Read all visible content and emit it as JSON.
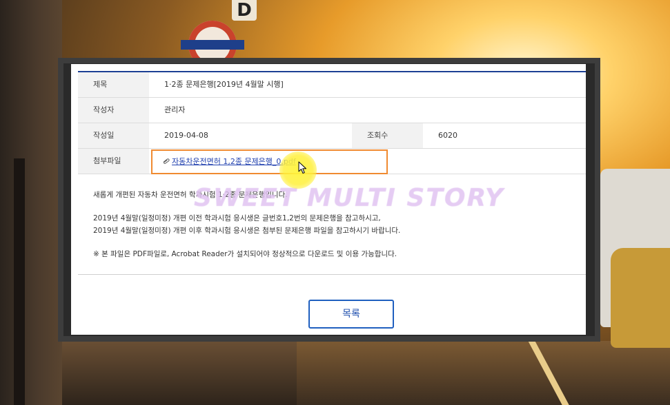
{
  "background": {
    "sign_letter": "D"
  },
  "post": {
    "rows": {
      "title": {
        "label": "제목",
        "value": "1·2종 문제은행[2019년 4월말 시행]"
      },
      "author": {
        "label": "작성자",
        "value": "관리자"
      },
      "date": {
        "label": "작성일",
        "value": "2019-04-08"
      },
      "views": {
        "label": "조회수",
        "value": "6020"
      },
      "attachment": {
        "label": "첨부파일",
        "file_name": "자동차운전면허 1,2종 문제은행_0.pdf",
        "icon": "paperclip-icon"
      }
    },
    "content": {
      "line1": "새롭게 개편된 자동차 운전면허 학과시험 1·2종 문제은행입니다.",
      "line2": "2019년 4월말(일정미정) 개편 이전 학과시험 응시생은 글번호1,2번의 문제은행을 참고하시고,",
      "line3": "2019년 4월말(일정미정) 개편 이후 학과시험 응시생은 첨부된 문제은행 파일을 참고하시기 바랍니다.",
      "line4": "※ 본 파일은 PDF파일로, Acrobat Reader가 설치되어야 정상적으로 다운로드 및 이용 가능합니다."
    },
    "watermark": "SWEET MULTI STORY",
    "list_button": "목록"
  },
  "colors": {
    "accent_line": "#1c3f94",
    "highlight_border": "#f08a30",
    "link": "#1f3fae",
    "button_border": "#1f5fbf"
  }
}
